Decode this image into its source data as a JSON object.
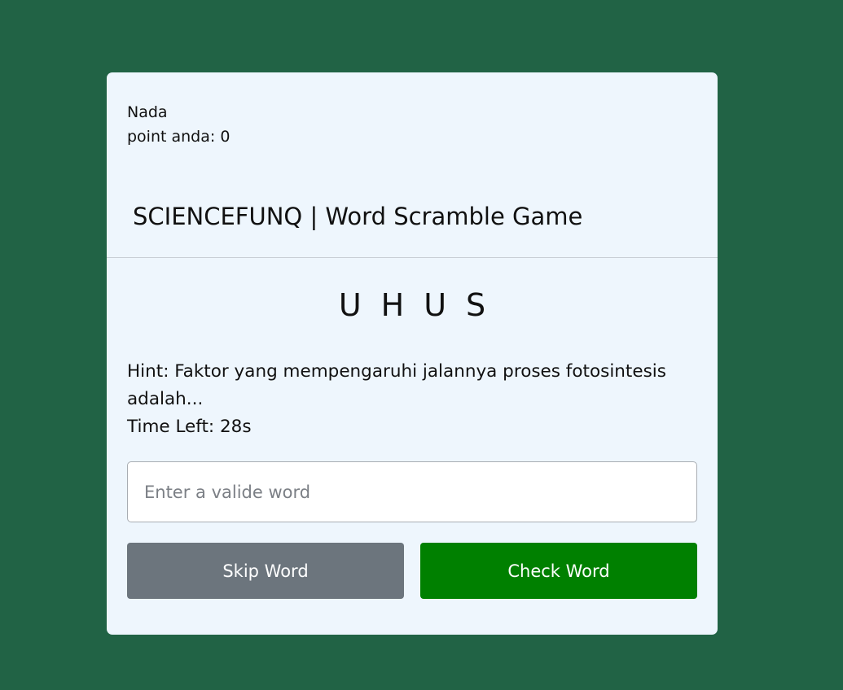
{
  "player": {
    "name": "Nada",
    "points_label": "point anda:",
    "points": "0"
  },
  "game": {
    "title": "SCIENCEFUNQ | Word Scramble Game",
    "scrambled_word": "UHUS",
    "hint": "Hint: Faktor yang mempengaruhi jalannya proses fotosintesis adalah...",
    "time_label": "Time Left:",
    "time_left": "28",
    "time_unit": "s"
  },
  "input": {
    "placeholder": "Enter a valide word",
    "value": ""
  },
  "buttons": {
    "skip_label": "Skip Word",
    "check_label": "Check Word"
  },
  "colors": {
    "background": "#216345",
    "card": "#eef6fd",
    "skip_button": "#6c757d",
    "check_button": "#008000"
  }
}
